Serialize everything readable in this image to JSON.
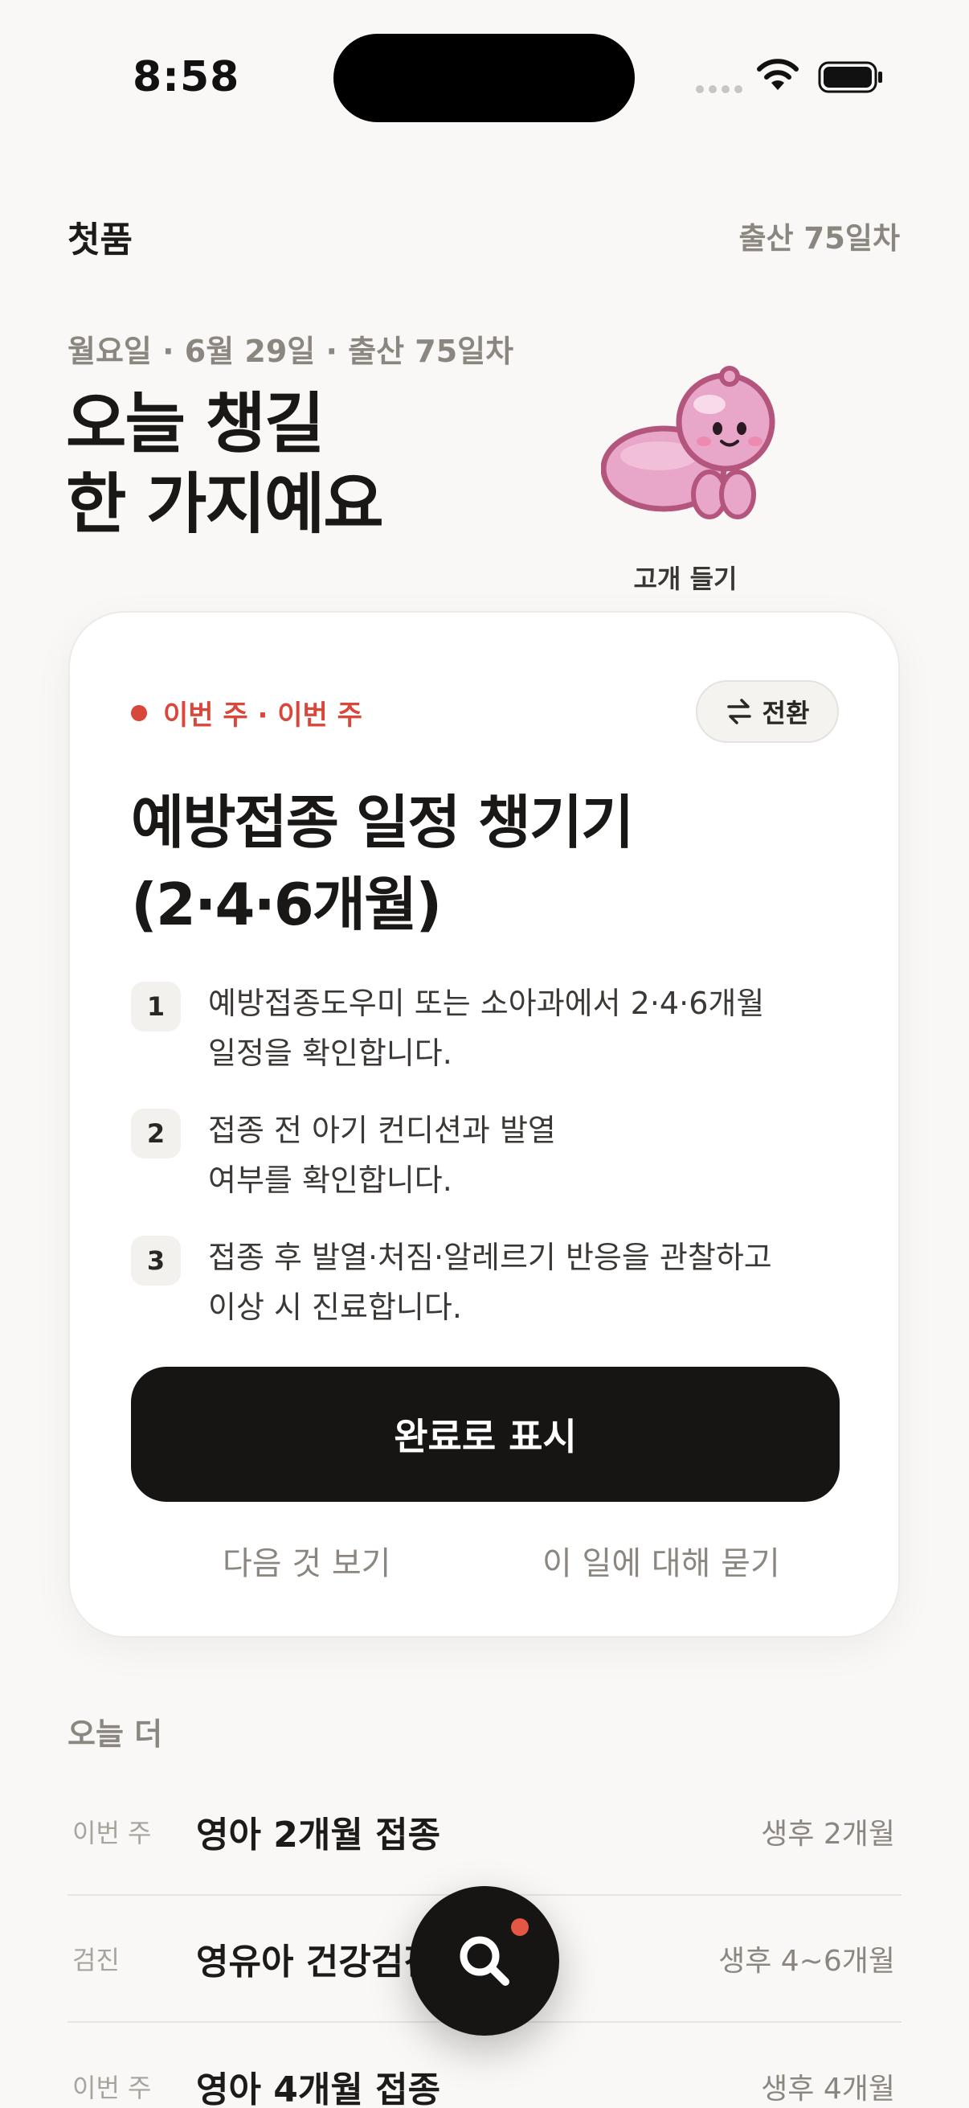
{
  "status_bar": {
    "time": "8:58"
  },
  "header": {
    "app_title": "첫품",
    "day_counter": "출산 75일차"
  },
  "hero": {
    "date_line": "월요일 · 6월 29일 · 출산 75일차",
    "headline_line1": "오늘 챙길",
    "headline_line2": "한 가지예요",
    "mascot_caption": "고개 들기"
  },
  "card": {
    "tag": "이번 주 · 이번 주",
    "switch_label": "전환",
    "title_line1": "예방접종 일정 챙기기",
    "title_line2": "(2·4·6개월)",
    "steps": [
      {
        "num": "1",
        "line1": "예방접종도우미 또는 소아과에서 2·4·6개월",
        "line2": "일정을 확인합니다."
      },
      {
        "num": "2",
        "line1": "접종 전 아기 컨디션과 발열",
        "line2": "여부를 확인합니다."
      },
      {
        "num": "3",
        "line1": "접종 후 발열·처짐·알레르기 반응을 관찰하고",
        "line2": "이상 시 진료합니다."
      }
    ],
    "primary_label": "완료로 표시",
    "next_label": "다음 것 보기",
    "ask_label": "이 일에 대해 묻기"
  },
  "today_more": {
    "label": "오늘 더",
    "items": [
      {
        "tag": "이번 주",
        "title": "영아 2개월 접종",
        "meta": "생후 2개월"
      },
      {
        "tag": "검진",
        "title": "영유아 건강검진",
        "meta": "생후 4~6개월"
      },
      {
        "tag": "이번 주",
        "title": "영아 4개월 접종",
        "meta": "생후 4개월"
      }
    ]
  },
  "colors": {
    "accent_red": "#d9463a",
    "primary_dark": "#171513",
    "mascot_pink": "#e8a6c8"
  },
  "icons": {
    "fab": "search-icon",
    "switch": "swap-arrows-icon"
  }
}
